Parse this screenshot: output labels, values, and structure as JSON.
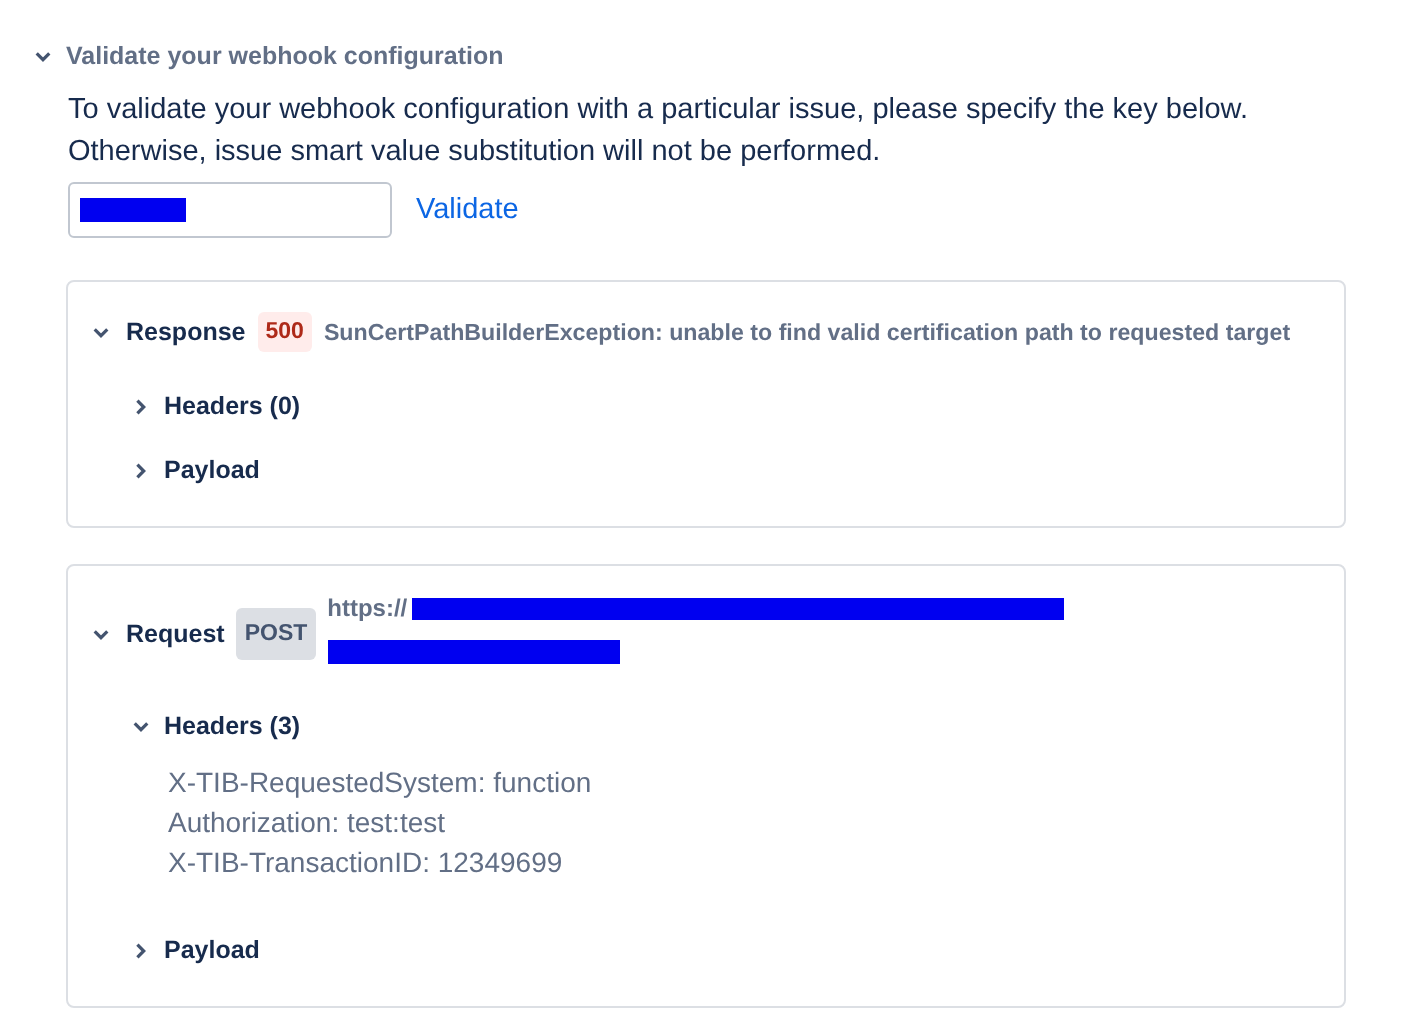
{
  "section": {
    "title": "Validate your webhook configuration",
    "expanded": true
  },
  "description": "To validate your webhook configuration with a particular issue, please specify the key below. Otherwise, issue smart value substitution will not be performed.",
  "issue_key_field": {
    "redacted": true
  },
  "validate_link": "Validate",
  "response": {
    "label": "Response",
    "expanded": true,
    "status": "500",
    "message": "SunCertPathBuilderException: unable to find valid certification path to requested target",
    "children": [
      {
        "label": "Headers (0)",
        "expanded": false
      },
      {
        "label": "Payload",
        "expanded": false
      }
    ]
  },
  "request": {
    "label": "Request",
    "expanded": true,
    "method": "POST",
    "url": "https://",
    "url_redacted": true,
    "children": [
      {
        "label": "Headers (3)",
        "expanded": true,
        "lines": [
          "X-TIB-RequestedSystem: function",
          "Authorization: test:test",
          "X-TIB-TransactionID: 12349699"
        ]
      },
      {
        "label": "Payload",
        "expanded": false
      }
    ]
  }
}
